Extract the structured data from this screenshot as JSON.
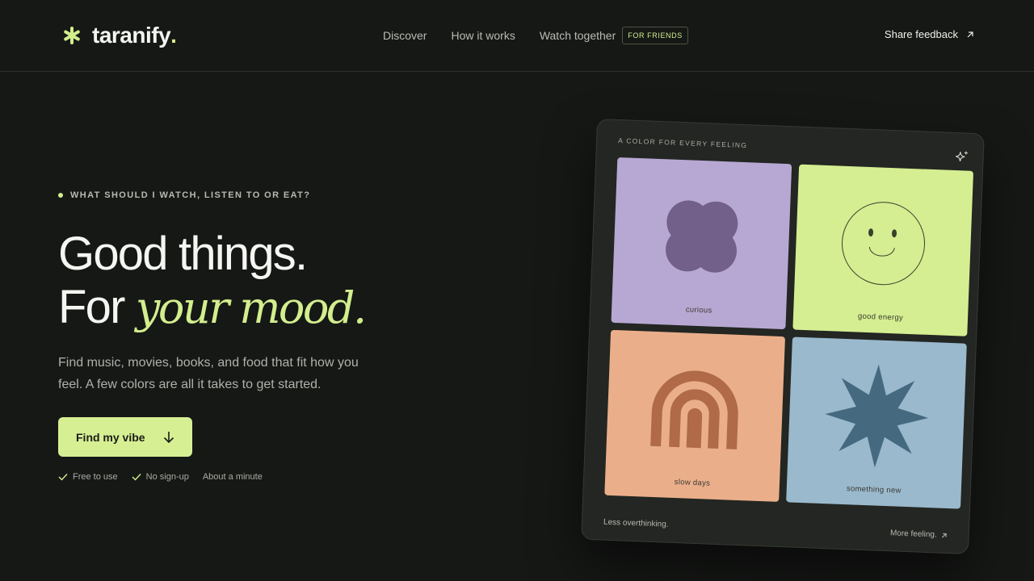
{
  "brand": {
    "name": "taranify",
    "dot": ".",
    "accent": "#d3ee8d"
  },
  "nav": {
    "items": [
      "Discover",
      "How it works",
      "Watch together"
    ],
    "badge": "FOR FRIENDS",
    "feedback": "Share feedback"
  },
  "hero": {
    "eyebrow": "WHAT SHOULD I WATCH, LISTEN TO OR EAT?",
    "title_line1": "Good things.",
    "title_line2_prefix": "For ",
    "title_line2_em": "your mood.",
    "subtitle": "Find music, movies, books, and food that fit how you feel. A few colors are all it takes to get started.",
    "cta": "Find my vibe",
    "perks": [
      "Free to use",
      "No sign-up",
      "About a minute"
    ]
  },
  "card": {
    "label": "A COLOR FOR EVERY FEELING",
    "tiles": [
      {
        "caption": "curious",
        "color": "#b7a8d3",
        "icon": "blob-icon"
      },
      {
        "caption": "good energy",
        "color": "#d5ee91",
        "icon": "smiley-icon"
      },
      {
        "caption": "slow days",
        "color": "#eaaf8a",
        "icon": "arch-icon"
      },
      {
        "caption": "something new",
        "color": "#9ab9cd",
        "icon": "starburst-icon"
      }
    ],
    "footer_left": "Less overthinking.",
    "footer_right": "More feeling."
  }
}
